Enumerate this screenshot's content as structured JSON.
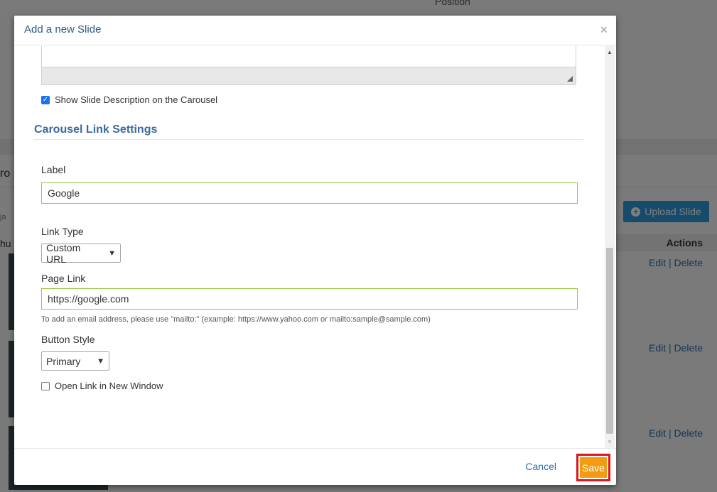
{
  "background": {
    "top_text": "Position",
    "upload_button": "Upload Slide",
    "actions_header": "Actions",
    "rows": [
      {
        "edit": "Edit",
        "sep": "|",
        "delete": "Delete"
      },
      {
        "edit": "Edit",
        "sep": "|",
        "delete": "Delete"
      },
      {
        "edit": "Edit",
        "sep": "|",
        "delete": "Delete"
      }
    ],
    "left_fragments": [
      "ro",
      "ja",
      "hu"
    ]
  },
  "modal": {
    "title": "Add a new Slide",
    "close_icon": "×",
    "show_description": {
      "label": "Show Slide Description on the Carousel",
      "checked": true
    },
    "section_title": "Carousel Link Settings",
    "label_field": {
      "label": "Label",
      "value": "Google"
    },
    "link_type": {
      "label": "Link Type",
      "value": "Custom URL"
    },
    "page_link": {
      "label": "Page Link",
      "value": "https://google.com",
      "help": "To add an email address, please use \"mailto:\" (example: https://www.yahoo.com or mailto:sample@sample.com)"
    },
    "button_style": {
      "label": "Button Style",
      "value": "Primary"
    },
    "new_window": {
      "label": "Open Link in New Window",
      "checked": false
    },
    "footer": {
      "cancel": "Cancel",
      "save": "Save"
    }
  },
  "colors": {
    "accent_save": "#f39c12",
    "save_highlight": "#e0141b",
    "link": "#2a6ead",
    "upload": "#2f96d8",
    "input_border": "#9bc53d"
  }
}
